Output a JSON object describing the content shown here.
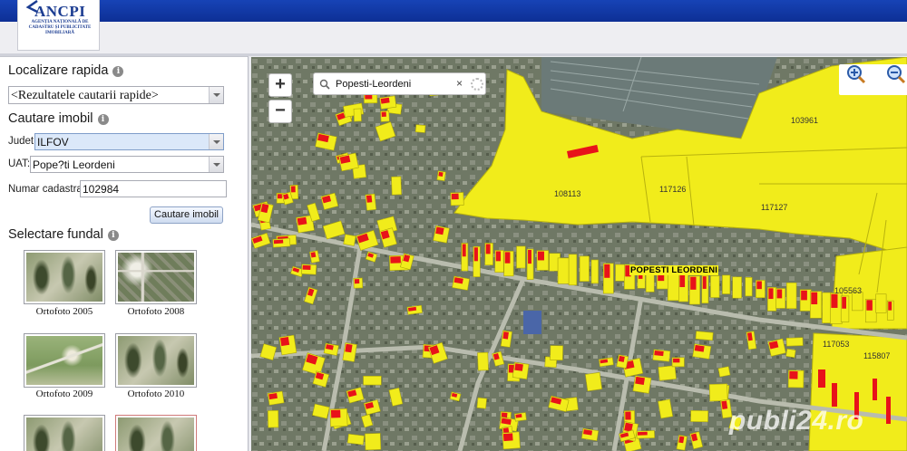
{
  "header": {
    "logo_name": "ANCPI",
    "logo_subtitle": "AGENȚIA NAȚIONALĂ DE CADASTRU ȘI PUBLICITATE IMOBILIARĂ",
    "brand_color": "#1c3d92"
  },
  "left_panel": {
    "quick_locate": {
      "title": "Localizare rapida",
      "combo_value": "<Rezultatele cautarii rapide>"
    },
    "property_search": {
      "title": "Cautare imobil",
      "county_label": "Judet:",
      "county_value": "ILFOV",
      "uat_label": "UAT:",
      "uat_value": "Pope?ti Leordeni",
      "cadastral_label": "Numar cadastral:",
      "cadastral_value": "102984",
      "search_button": "Cautare imobil"
    },
    "basemap": {
      "title": "Selectare fundal",
      "options": [
        {
          "label": "Ortofoto 2005"
        },
        {
          "label": "Ortofoto 2008"
        },
        {
          "label": "Ortofoto 2009"
        },
        {
          "label": "Ortofoto 2010"
        },
        {
          "label": ""
        },
        {
          "label": ""
        }
      ]
    }
  },
  "map": {
    "zoom_in": "+",
    "zoom_out": "−",
    "search_query": "Popesti-Leordeni",
    "clear_symbol": "×",
    "place_label": "POPESTI LEORDENI",
    "parcels": [
      "103961",
      "108113",
      "117126",
      "117127",
      "105563",
      "117053",
      "115807"
    ],
    "parcel_color": "#f1ec1b",
    "building_color": "#e8121a",
    "watermark": "publi24.ro"
  }
}
